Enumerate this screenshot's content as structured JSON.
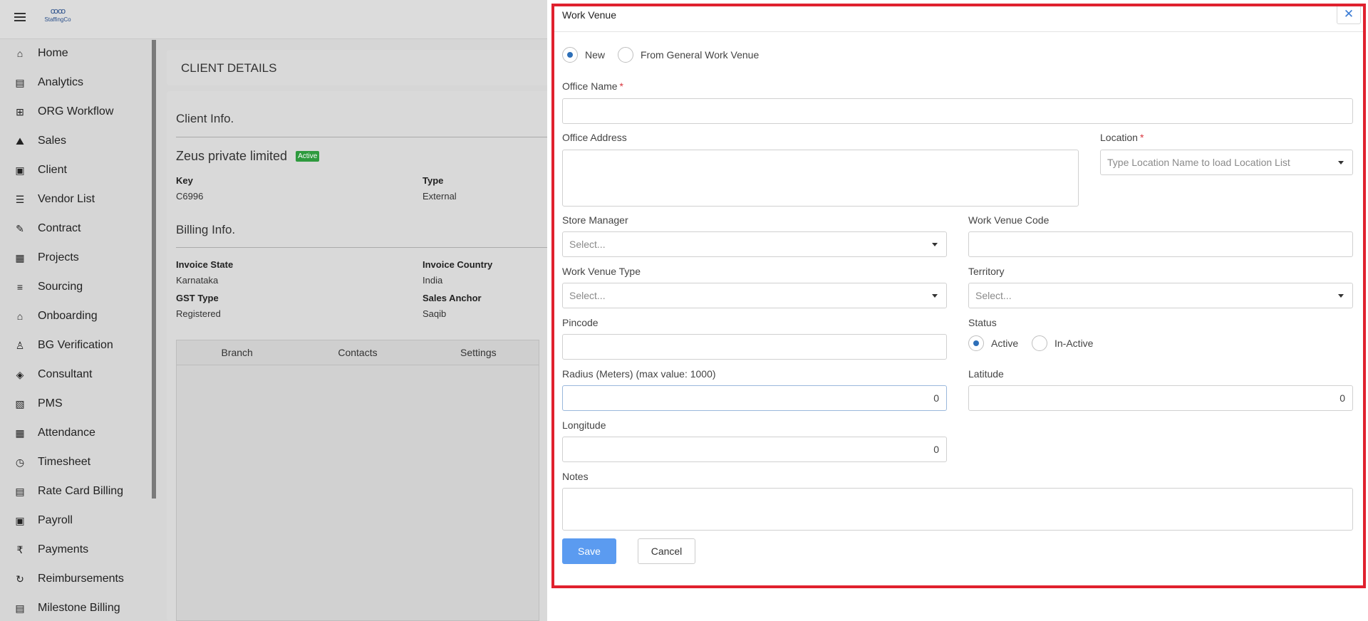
{
  "app": {
    "logo_text": "StaffingCo"
  },
  "sidebar": {
    "items": [
      {
        "label": "Home",
        "icon": "home-icon",
        "glyph": "⌂"
      },
      {
        "label": "Analytics",
        "icon": "analytics-icon",
        "glyph": "▤"
      },
      {
        "label": "ORG Workflow",
        "icon": "workflow-icon",
        "glyph": "⊞"
      },
      {
        "label": "Sales",
        "icon": "sales-icon",
        "glyph": "⛰"
      },
      {
        "label": "Client",
        "icon": "client-icon",
        "glyph": "▣"
      },
      {
        "label": "Vendor List",
        "icon": "vendor-icon",
        "glyph": "☰"
      },
      {
        "label": "Contract",
        "icon": "contract-icon",
        "glyph": "✎"
      },
      {
        "label": "Projects",
        "icon": "projects-icon",
        "glyph": "▦"
      },
      {
        "label": "Sourcing",
        "icon": "sourcing-icon",
        "glyph": "≡"
      },
      {
        "label": "Onboarding",
        "icon": "onboarding-icon",
        "glyph": "⌂"
      },
      {
        "label": "BG Verification",
        "icon": "bg-verification-icon",
        "glyph": "♙"
      },
      {
        "label": "Consultant",
        "icon": "consultant-icon",
        "glyph": "◈"
      },
      {
        "label": "PMS",
        "icon": "pms-icon",
        "glyph": "▧"
      },
      {
        "label": "Attendance",
        "icon": "attendance-icon",
        "glyph": "▦"
      },
      {
        "label": "Timesheet",
        "icon": "timesheet-icon",
        "glyph": "◷"
      },
      {
        "label": "Rate Card Billing",
        "icon": "rate-card-icon",
        "glyph": "▤"
      },
      {
        "label": "Payroll",
        "icon": "payroll-icon",
        "glyph": "▣"
      },
      {
        "label": "Payments",
        "icon": "rupee-icon",
        "glyph": "₹"
      },
      {
        "label": "Reimbursements",
        "icon": "reimbursements-icon",
        "glyph": "↻"
      },
      {
        "label": "Milestone Billing",
        "icon": "milestone-icon",
        "glyph": "▤"
      }
    ]
  },
  "client_details": {
    "title": "CLIENT DETAILS",
    "client_info_heading": "Client Info.",
    "company_name": "Zeus private limited",
    "status_badge": "Active",
    "key_label": "Key",
    "key_value": "C6996",
    "type_label": "Type",
    "type_value": "External",
    "billing_heading": "Billing Info.",
    "invoice_state_label": "Invoice State",
    "invoice_state_value": "Karnataka",
    "invoice_country_label": "Invoice Country",
    "invoice_country_value": "India",
    "gst_type_label": "GST Type",
    "gst_type_value": "Registered",
    "sales_anchor_label": "Sales Anchor",
    "sales_anchor_value": "Saqib",
    "tabs": [
      "Branch",
      "Contacts",
      "Settings"
    ]
  },
  "modal": {
    "title": "Work Venue",
    "close_glyph": "✕",
    "source_options": [
      {
        "label": "New",
        "checked": true
      },
      {
        "label": "From General Work Venue",
        "checked": false
      }
    ],
    "office_name_label": "Office Name",
    "office_name_value": "",
    "required_mark": "*",
    "office_address_label": "Office Address",
    "office_address_value": "",
    "location_label": "Location",
    "location_placeholder": "Type Location Name to load Location List",
    "store_manager_label": "Store Manager",
    "store_manager_value": "Select...",
    "work_venue_code_label": "Work Venue Code",
    "work_venue_code_value": "",
    "work_venue_type_label": "Work Venue Type",
    "work_venue_type_value": "Select...",
    "territory_label": "Territory",
    "territory_value": "Select...",
    "pincode_label": "Pincode",
    "pincode_value": "",
    "status_label": "Status",
    "status_options": [
      {
        "label": "Active",
        "checked": true
      },
      {
        "label": "In-Active",
        "checked": false
      }
    ],
    "radius_label": "Radius (Meters) (max value: 1000)",
    "radius_value": "0",
    "latitude_label": "Latitude",
    "latitude_value": "0",
    "longitude_label": "Longitude",
    "longitude_value": "0",
    "notes_label": "Notes",
    "notes_value": "",
    "save_label": "Save",
    "cancel_label": "Cancel"
  }
}
